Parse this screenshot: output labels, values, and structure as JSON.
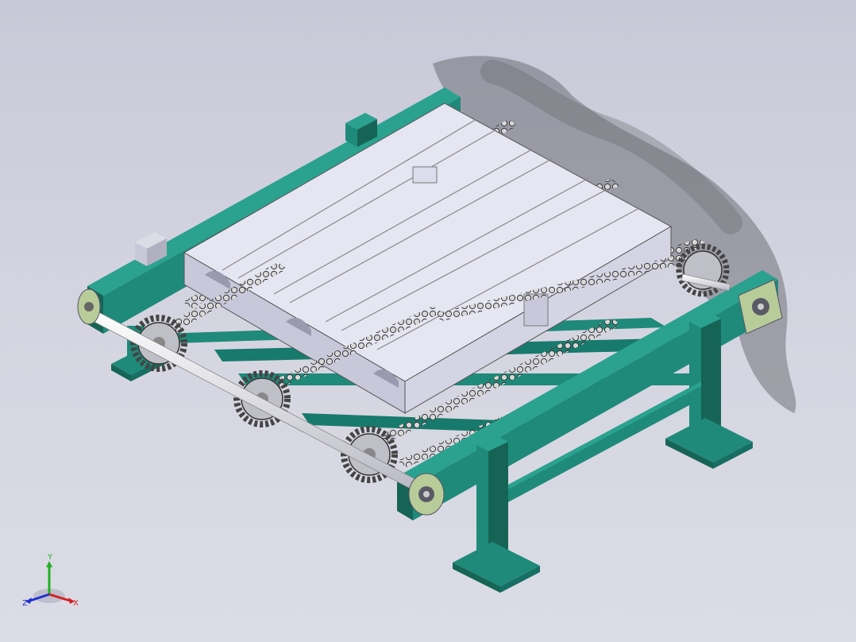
{
  "viewport": {
    "background_top": "#c8c8d8",
    "background_bottom": "#dcdce6"
  },
  "model": {
    "frame_color": "#1f8a7a",
    "frame_dark": "#166456",
    "pallet_color": "#e6e6f2",
    "pallet_shade": "#c8c8da",
    "shaft_color": "#f2f2f6",
    "chain_color": "#9a9a9a",
    "bearing_color": "#b8cc9a"
  },
  "triad": {
    "x_label": "X",
    "y_label": "Y",
    "z_label": "Z",
    "x_color": "#d42020",
    "y_color": "#20b020",
    "z_color": "#2030d0"
  }
}
